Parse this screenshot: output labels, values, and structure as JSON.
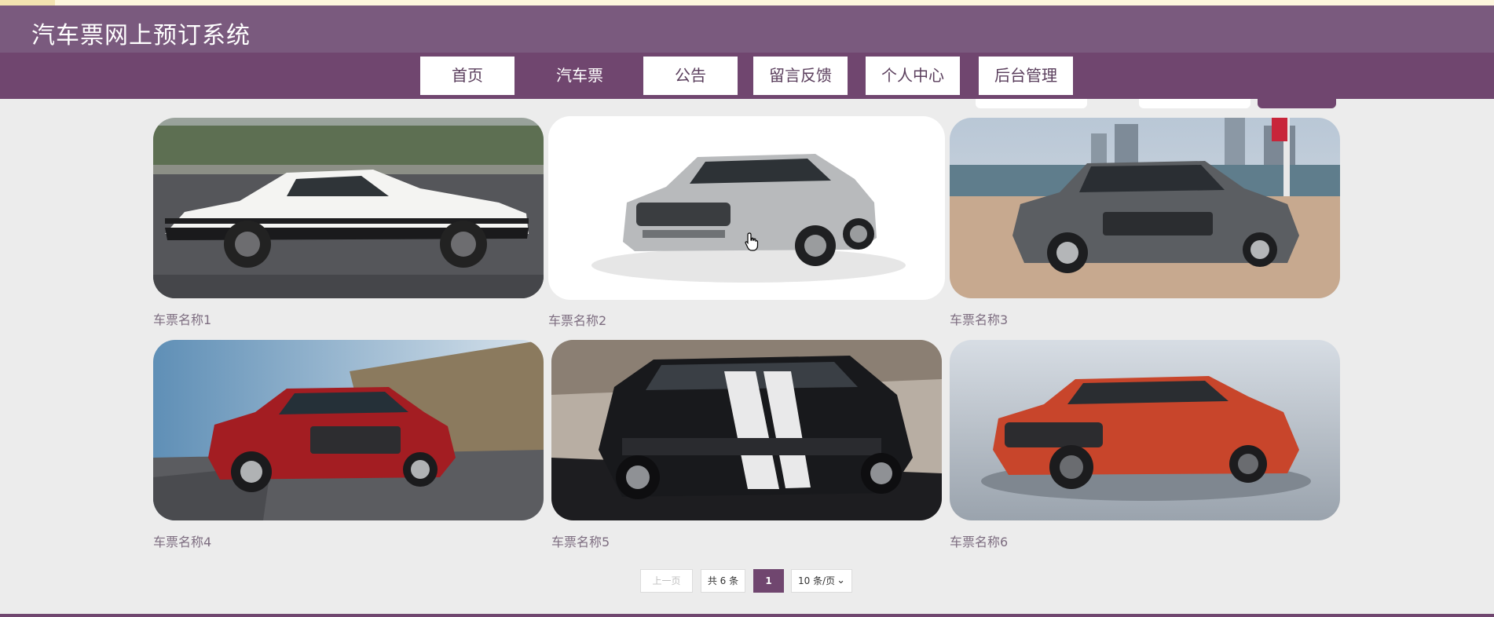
{
  "site": {
    "title": "汽车票网上预订系统"
  },
  "nav": {
    "items": [
      {
        "label": "首页",
        "active": false
      },
      {
        "label": "汽车票",
        "active": true
      },
      {
        "label": "公告",
        "active": false
      },
      {
        "label": "留言反馈",
        "active": false
      },
      {
        "label": "个人中心",
        "active": false
      },
      {
        "label": "后台管理",
        "active": false
      }
    ]
  },
  "cards": [
    {
      "name": "车票名称1",
      "image": "white-black-coupe-on-track"
    },
    {
      "name": "车票名称2",
      "image": "silver-suv-white-background"
    },
    {
      "name": "车票名称3",
      "image": "grey-sedan-waterfront"
    },
    {
      "name": "车票名称4",
      "image": "red-suv-on-road"
    },
    {
      "name": "车票名称5",
      "image": "black-muscle-car-white-stripes"
    },
    {
      "name": "车票名称6",
      "image": "orange-suv-studio"
    }
  ],
  "pagination": {
    "prev_label": "上一页",
    "total_label": "共 6 条",
    "current_page": "1",
    "page_size_label": "10 条/页",
    "chevron_icon": "chevron-down-icon"
  },
  "colors": {
    "header": "#7a5a7e",
    "nav": "#70466f",
    "accent": "#70466f",
    "background": "#ececec"
  }
}
